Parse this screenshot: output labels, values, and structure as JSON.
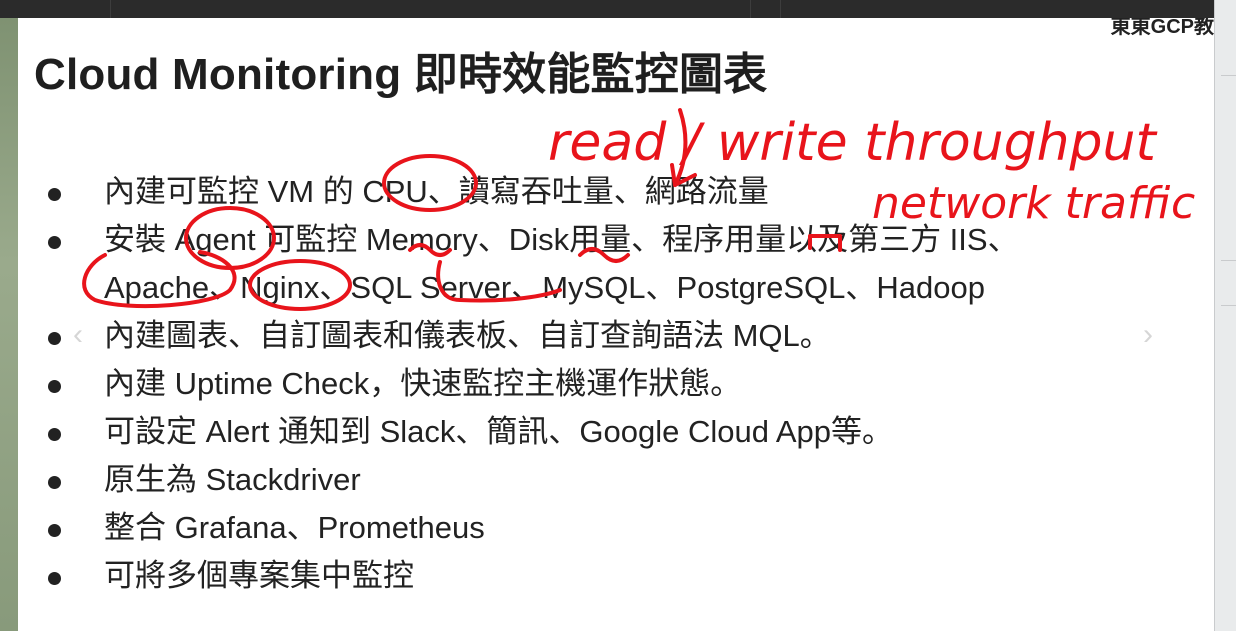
{
  "slide": {
    "brand": "東東GCP教",
    "title": "Cloud Monitoring 即時效能監控圖表",
    "bullets": [
      "內建可監控 VM 的 CPU、讀寫吞吐量、網路流量",
      "安裝 Agent 可監控 Memory、Disk用量、程序用量以及第三方 IIS、",
      "Apache、Nginx、SQL Server、MySQL、PostgreSQL、Hadoop",
      "內建圖表、自訂圖表和儀表板、自訂查詢語法 MQL。",
      "內建 Uptime Check，快速監控主機運作狀態。",
      "可設定 Alert 通知到 Slack、簡訊、Google Cloud App等。",
      "原生為 Stackdriver",
      "整合 Grafana、Prometheus",
      "可將多個專案集中監控"
    ],
    "nav": {
      "prev": "‹",
      "next": "›"
    }
  },
  "annotations": {
    "handwriting_1": "read / write throughput",
    "handwriting_2": "network traffic",
    "ink_color": "#e8141b"
  }
}
